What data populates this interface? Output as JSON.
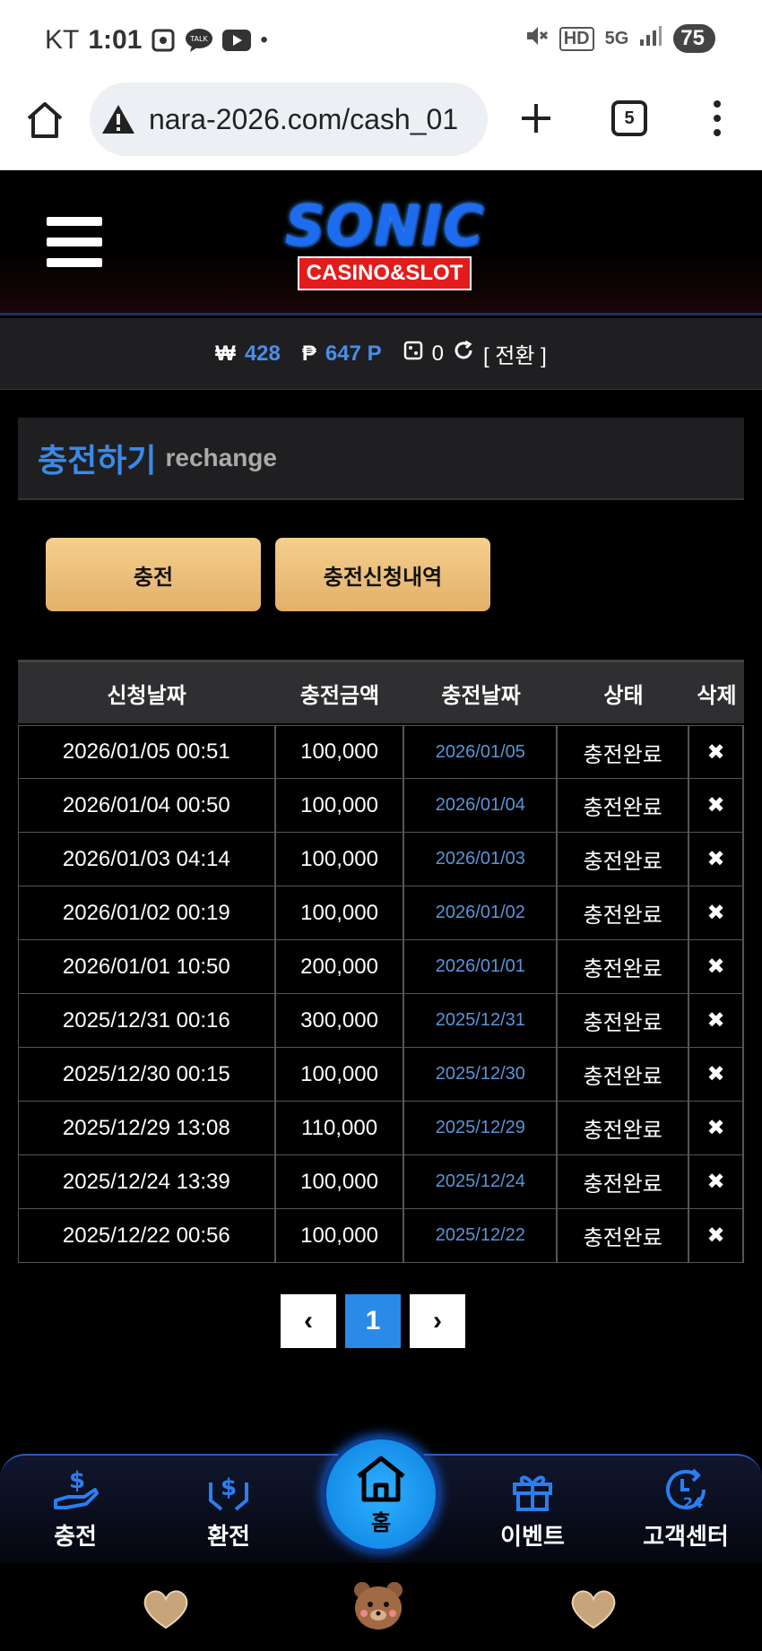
{
  "status_bar": {
    "carrier": "KT",
    "time": "1:01",
    "talk_badge": "TALK",
    "network": "5G",
    "hd": "HD",
    "battery": "75"
  },
  "browser": {
    "url": "nara-2026.com/cash_01",
    "tab_count": "5"
  },
  "site": {
    "logo_main": "SONIC",
    "logo_sub": "CASINO&SLOT"
  },
  "balance": {
    "won_symbol": "₩",
    "won_value": "428",
    "point_symbol": "₱",
    "point_value": "647 P",
    "chip_value": "0",
    "switch_label": "[ 전환 ]"
  },
  "section": {
    "title_ko": "충전하기",
    "title_en": "rechange"
  },
  "buttons": {
    "charge": "충전",
    "history": "충전신청내역"
  },
  "table": {
    "headers": [
      "신청날짜",
      "충전금액",
      "충전날짜",
      "상태",
      "삭제"
    ],
    "rows": [
      {
        "requested": "2026/01/05 00:51",
        "amount": "100,000",
        "charged": "2026/01/05",
        "status": "충전완료",
        "del": "✖"
      },
      {
        "requested": "2026/01/04 00:50",
        "amount": "100,000",
        "charged": "2026/01/04",
        "status": "충전완료",
        "del": "✖"
      },
      {
        "requested": "2026/01/03 04:14",
        "amount": "100,000",
        "charged": "2026/01/03",
        "status": "충전완료",
        "del": "✖"
      },
      {
        "requested": "2026/01/02 00:19",
        "amount": "100,000",
        "charged": "2026/01/02",
        "status": "충전완료",
        "del": "✖"
      },
      {
        "requested": "2026/01/01 10:50",
        "amount": "200,000",
        "charged": "2026/01/01",
        "status": "충전완료",
        "del": "✖"
      },
      {
        "requested": "2025/12/31 00:16",
        "amount": "300,000",
        "charged": "2025/12/31",
        "status": "충전완료",
        "del": "✖"
      },
      {
        "requested": "2025/12/30 00:15",
        "amount": "100,000",
        "charged": "2025/12/30",
        "status": "충전완료",
        "del": "✖"
      },
      {
        "requested": "2025/12/29 13:08",
        "amount": "110,000",
        "charged": "2025/12/29",
        "status": "충전완료",
        "del": "✖"
      },
      {
        "requested": "2025/12/24 13:39",
        "amount": "100,000",
        "charged": "2025/12/24",
        "status": "충전완료",
        "del": "✖"
      },
      {
        "requested": "2025/12/22 00:56",
        "amount": "100,000",
        "charged": "2025/12/22",
        "status": "충전완료",
        "del": "✖"
      }
    ]
  },
  "pagination": {
    "prev": "‹",
    "current": "1",
    "next": "›"
  },
  "bottom_nav": {
    "charge": "충전",
    "exchange": "환전",
    "home": "홈",
    "event": "이벤트",
    "support": "고객센터"
  },
  "colors": {
    "accent_blue": "#3a8ae8",
    "gold": "#e8b56c",
    "logo_red": "#e41b1b"
  }
}
